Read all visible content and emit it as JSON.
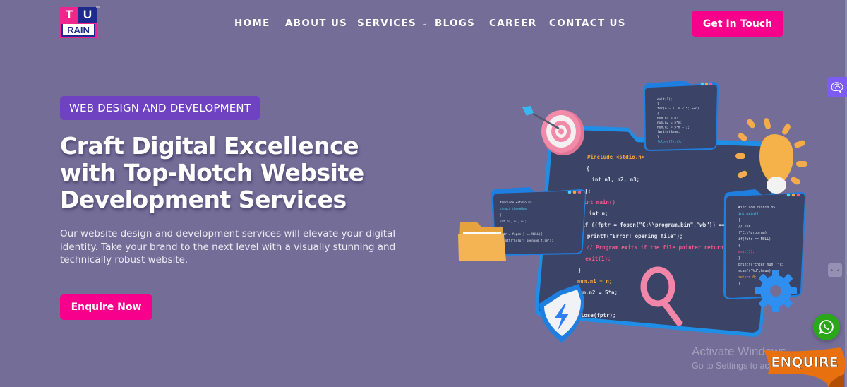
{
  "header": {
    "logo": {
      "top_left": "T",
      "top_right": "U",
      "bottom": "RAIN",
      "trademark": "TM"
    },
    "nav": [
      {
        "label": "HOME"
      },
      {
        "label": "ABOUT US"
      },
      {
        "label": "SERVICES",
        "has_dropdown": true
      },
      {
        "label": "BLOGS"
      },
      {
        "label": "CAREER"
      },
      {
        "label": "CONTACT US"
      }
    ],
    "cta_label": "Get In Touch"
  },
  "hero": {
    "badge": "WEB DESIGN AND DEVELOPMENT",
    "title": "Craft Digital Excellence with Top-Notch Website Development Services",
    "description": "Our website design and development services will elevate your digital identity. Take your brand to the next level with a visually stunning and technically robust website.",
    "cta_label": "Enquire Now"
  },
  "illustration": {
    "main_code": [
      "#include <stdio.h>",
      "{",
      "   int n1, n2, n3;",
      "};",
      "int main()",
      "   int n;",
      "if ((fptr = fopen(\"C:\\\\program.bin\",\"wb\")) == NUL",
      "   printf(\"Error! opening file\");",
      "   // Program exits if the file pointer returns",
      "   exit(1);",
      "}",
      "num.n1 = n;",
      "num.n2 = 5*n;",
      "}",
      "fclose(fptr);"
    ],
    "top_card_code": [
      "exit(1);",
      "}",
      "for(n = 1; n < 5; ++n)",
      "{",
      "num.n1 = n;",
      "num.n2 = 5*n;",
      "num.n3 = 5*n + 1;",
      "fwrite(&num,",
      "}",
      "fclose(fptr);"
    ],
    "right_card_code": [
      "#include <stdio.h>",
      "int main()",
      "{",
      "// use",
      "(\"C:\\\\program)",
      "if(fptr == NULL)",
      "{",
      "exit(1);",
      "}",
      "printf(\"Enter num: \");",
      "scanf(\"%d\",&num)",
      "return 0;",
      "}"
    ],
    "left_card_code": [
      "#include <stdio.h>",
      "struct threeNum",
      "{",
      "int n1, n2, n3;",
      "};",
      "fptr = fopen() == NULL){",
      "printf(\"Error! opening file\");"
    ]
  },
  "widgets": {
    "brain_icon": "brain-icon",
    "emoji_label": ">_<",
    "whatsapp_icon": "whatsapp-icon",
    "enquire_ribbon": "ENQUIRE"
  },
  "os_overlay": {
    "line1": "Activate Windows",
    "line2": "Go to Settings to activate Windows."
  },
  "colors": {
    "background": "#736d98",
    "accent_pink": "#f7008c",
    "badge_purple": "#6f42c1",
    "whatsapp_green": "#2aa81a",
    "ribbon_orange": "#e8700f"
  }
}
